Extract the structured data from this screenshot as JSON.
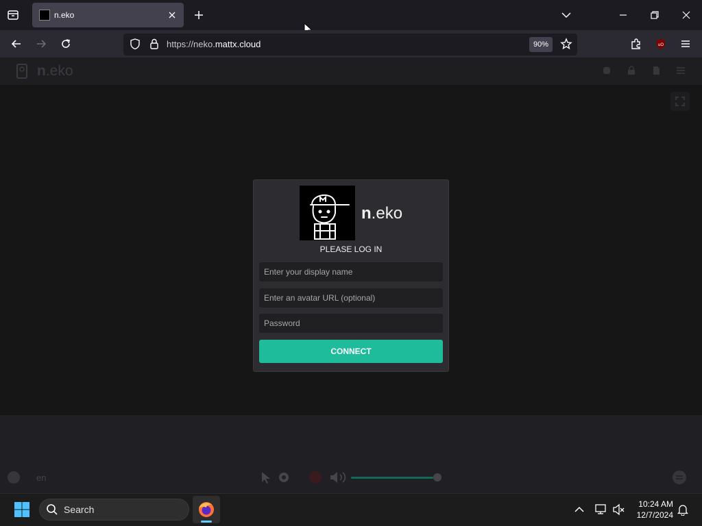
{
  "browser": {
    "tab_title": "n.eko",
    "url_prefix": "https://neko.",
    "url_domain": "mattx.cloud",
    "zoom": "90%"
  },
  "neko": {
    "brand_bold": "n",
    "brand_rest": ".eko",
    "language": "en"
  },
  "login": {
    "brand_bold": "n",
    "brand_rest": ".eko",
    "title": "PLEASE LOG IN",
    "display_name_placeholder": "Enter your display name",
    "avatar_placeholder": "Enter an avatar URL (optional)",
    "password_placeholder": "Password",
    "connect_label": "CONNECT"
  },
  "volume_level": 1.0,
  "taskbar": {
    "search_label": "Search",
    "time": "10:24 AM",
    "date": "12/7/2024"
  },
  "colors": {
    "accent": "#1fbc9c",
    "browser_bg": "#1c1b22"
  }
}
